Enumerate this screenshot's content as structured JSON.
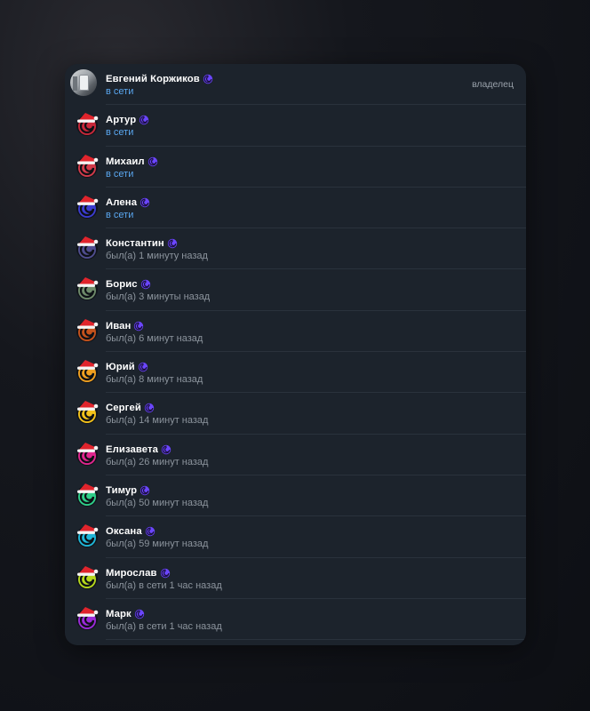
{
  "members": [
    {
      "name": "Евгений Коржиков",
      "status": "в сети",
      "online": true,
      "role": "владелец",
      "avatar": "photo",
      "avatar_color": ""
    },
    {
      "name": "Артур",
      "status": "в сети",
      "online": true,
      "role": "",
      "avatar": "santa",
      "avatar_color": "#c8283a"
    },
    {
      "name": "Михаил",
      "status": "в сети",
      "online": true,
      "role": "",
      "avatar": "santa",
      "avatar_color": "#d23a4a"
    },
    {
      "name": "Алена",
      "status": "в сети",
      "online": true,
      "role": "",
      "avatar": "santa",
      "avatar_color": "#3b3ccf"
    },
    {
      "name": "Константин",
      "status": "был(а) 1 минуту назад",
      "online": false,
      "role": "",
      "avatar": "santa",
      "avatar_color": "#4f4d8e"
    },
    {
      "name": "Борис",
      "status": "был(а) 3 минуты назад",
      "online": false,
      "role": "",
      "avatar": "santa",
      "avatar_color": "#6e8a6a"
    },
    {
      "name": "Иван",
      "status": "был(а) 6 минут назад",
      "online": false,
      "role": "",
      "avatar": "santa",
      "avatar_color": "#c4521c"
    },
    {
      "name": "Юрий",
      "status": "был(а) 8 минут назад",
      "online": false,
      "role": "",
      "avatar": "santa",
      "avatar_color": "#f0a020"
    },
    {
      "name": "Сергей",
      "status": "был(а) 14 минут назад",
      "online": false,
      "role": "",
      "avatar": "santa",
      "avatar_color": "#f3c21a"
    },
    {
      "name": "Елизавета",
      "status": "был(а) 26 минут назад",
      "online": false,
      "role": "",
      "avatar": "santa",
      "avatar_color": "#e0268e"
    },
    {
      "name": "Тимур",
      "status": "был(а) 50 минут назад",
      "online": false,
      "role": "",
      "avatar": "santa",
      "avatar_color": "#2fcf8a"
    },
    {
      "name": "Оксана",
      "status": "был(а) 59 минут назад",
      "online": false,
      "role": "",
      "avatar": "santa",
      "avatar_color": "#1fb6d8"
    },
    {
      "name": "Мирослав",
      "status": "был(а) в сети 1 час назад",
      "online": false,
      "role": "",
      "avatar": "santa",
      "avatar_color": "#b6d81c"
    },
    {
      "name": "Марк",
      "status": "был(а) в сети 1 час назад",
      "online": false,
      "role": "",
      "avatar": "santa",
      "avatar_color": "#9a2ad8"
    }
  ],
  "colors": {
    "panel": "#1c232c",
    "online": "#5aa7f0",
    "muted": "#8c949d",
    "emoji_status": "#6b46ff"
  },
  "icons": {
    "status_emoji": "swirl-premium-icon",
    "member_avatar": "santa-hat-avatar-icon"
  }
}
